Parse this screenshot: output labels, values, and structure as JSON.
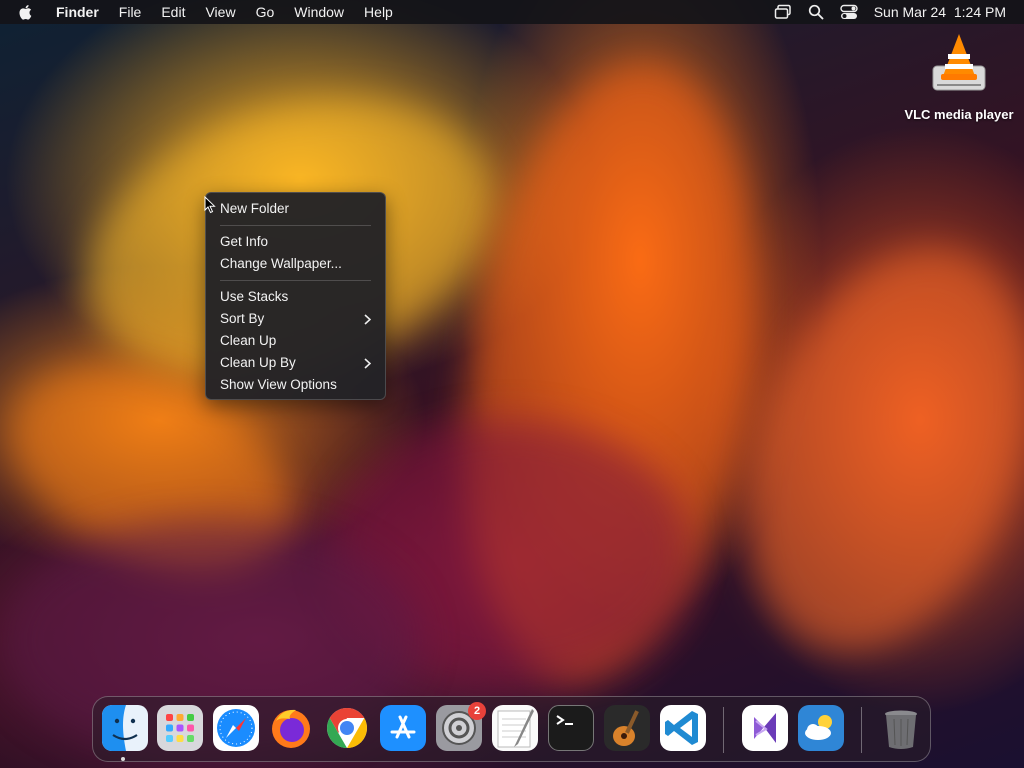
{
  "menubar": {
    "app_name": "Finder",
    "menus": [
      "File",
      "Edit",
      "View",
      "Go",
      "Window",
      "Help"
    ],
    "clock": "Sun Mar 24  1:24 PM"
  },
  "desktop": {
    "icons": [
      {
        "label": "VLC media player",
        "icon": "vlc-drive-icon"
      }
    ]
  },
  "context_menu": {
    "groups": [
      [
        {
          "label": "New Folder"
        }
      ],
      [
        {
          "label": "Get Info"
        },
        {
          "label": "Change Wallpaper..."
        }
      ],
      [
        {
          "label": "Use Stacks"
        },
        {
          "label": "Sort By",
          "submenu": true
        },
        {
          "label": "Clean Up"
        },
        {
          "label": "Clean Up By",
          "submenu": true
        },
        {
          "label": "Show View Options"
        }
      ]
    ]
  },
  "dock": {
    "apps": [
      {
        "name": "finder-icon",
        "running": true
      },
      {
        "name": "launchpad-icon"
      },
      {
        "name": "safari-icon"
      },
      {
        "name": "firefox-icon"
      },
      {
        "name": "chrome-icon"
      },
      {
        "name": "app-store-icon"
      },
      {
        "name": "system-settings-icon",
        "badge": "2"
      },
      {
        "name": "textedit-icon"
      },
      {
        "name": "terminal-icon"
      },
      {
        "name": "garageband-icon"
      },
      {
        "name": "vscode-icon"
      },
      {
        "name": "visual-studio-icon"
      },
      {
        "name": "weather-icon"
      },
      {
        "name": "trash-icon"
      }
    ]
  },
  "colors": {
    "menu_bg": "#222226",
    "badge": "#e8413a",
    "accent": "#2e7cf6"
  }
}
